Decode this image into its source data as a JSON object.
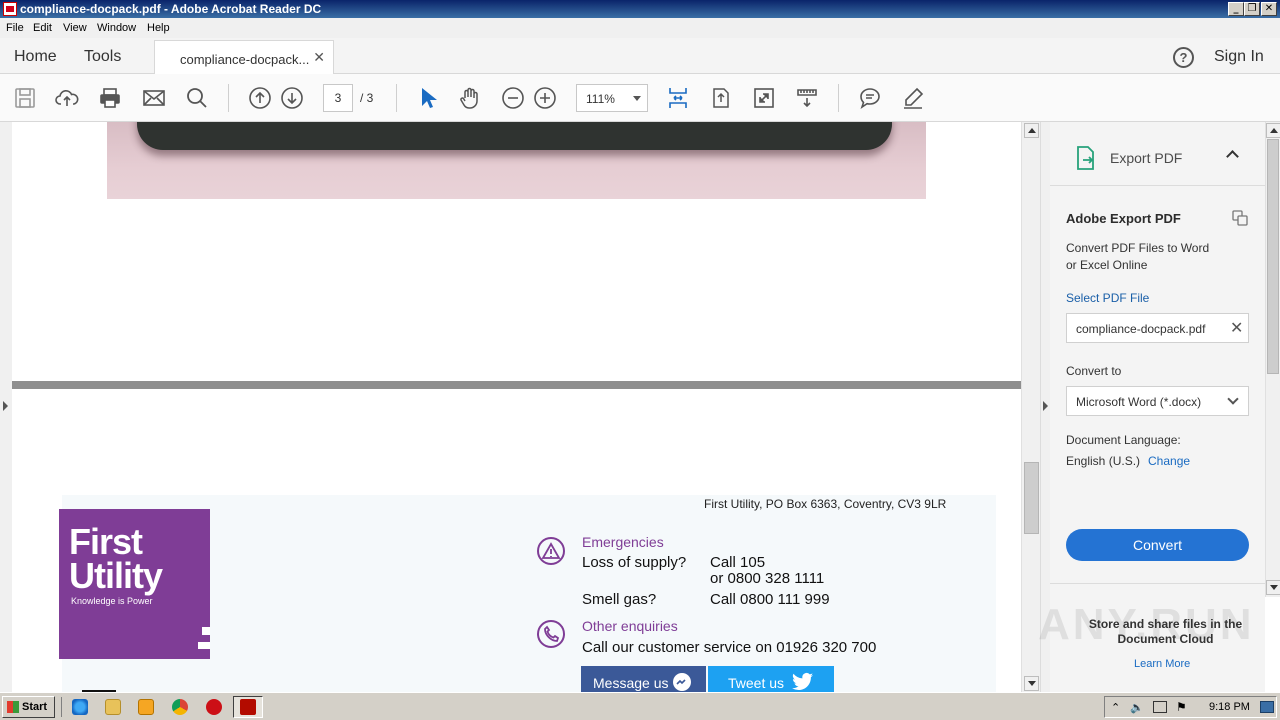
{
  "window": {
    "title": "compliance-docpack.pdf - Adobe Acrobat Reader DC"
  },
  "menu": [
    "File",
    "Edit",
    "View",
    "Window",
    "Help"
  ],
  "tabs": {
    "home": "Home",
    "tools": "Tools",
    "document": "compliance-docpack...",
    "sign_in": "Sign In"
  },
  "toolbar": {
    "current_page": "3",
    "total_pages": "/ 3",
    "zoom": "111%"
  },
  "document": {
    "address": "First Utility, PO Box 6363, Coventry, CV3 9LR",
    "logo": {
      "line1": "First",
      "line2": "Utility",
      "tagline": "Knowledge is Power"
    },
    "emergencies": {
      "heading": "Emergencies",
      "loss_label": "Loss of supply?",
      "loss_call1": "Call 105",
      "loss_call2": "or 0800 328 1111",
      "gas_label": "Smell gas?",
      "gas_call": "Call 0800 111 999"
    },
    "enquiries": {
      "heading": "Other enquiries",
      "text": "Call our customer service on 01926 320 700"
    },
    "buttons": {
      "message": "Message us",
      "tweet": "Tweet us"
    }
  },
  "export_pane": {
    "header": "Export PDF",
    "title": "Adobe Export PDF",
    "description1": "Convert PDF Files to Word",
    "description2": "or Excel Online",
    "select_label": "Select PDF File",
    "file_name": "compliance-docpack.pdf",
    "convert_to_label": "Convert to",
    "format": "Microsoft Word (*.docx)",
    "language_label": "Document Language:",
    "language": "English (U.S.)",
    "change_link": "Change",
    "convert_button": "Convert",
    "store_text": "Store and share files in the Document Cloud",
    "learn_more": "Learn More",
    "watermark": "ANY.RUN"
  },
  "taskbar": {
    "start": "Start",
    "clock": "9:18 PM"
  },
  "colors": {
    "accent_blue": "#2473d3",
    "brand_purple": "#7f3d96",
    "messenger_blue": "#3b5998",
    "twitter_blue": "#1da1f2"
  }
}
